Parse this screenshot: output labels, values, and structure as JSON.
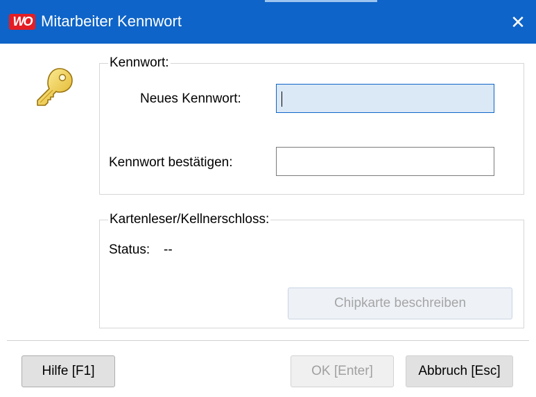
{
  "window": {
    "title": "Mitarbeiter Kennwort",
    "logo_text": "WO",
    "close_symbol": "✕",
    "titlebar_color": "#0e64c8"
  },
  "password_group": {
    "legend": "Kennwort:",
    "new_password_label": "Neues Kennwort:",
    "new_password_value": "",
    "confirm_label": "Kennwort bestätigen:",
    "confirm_value": ""
  },
  "card_group": {
    "legend": "Kartenleser/Kellnerschloss:",
    "status_label": "Status:",
    "status_value": "--",
    "chip_button": "Chipkarte beschreiben"
  },
  "footer": {
    "help_button": "Hilfe [F1]",
    "ok_button": "OK [Enter]",
    "cancel_button": "Abbruch [Esc]"
  },
  "icons": {
    "key": "key-icon",
    "close": "close-icon"
  }
}
